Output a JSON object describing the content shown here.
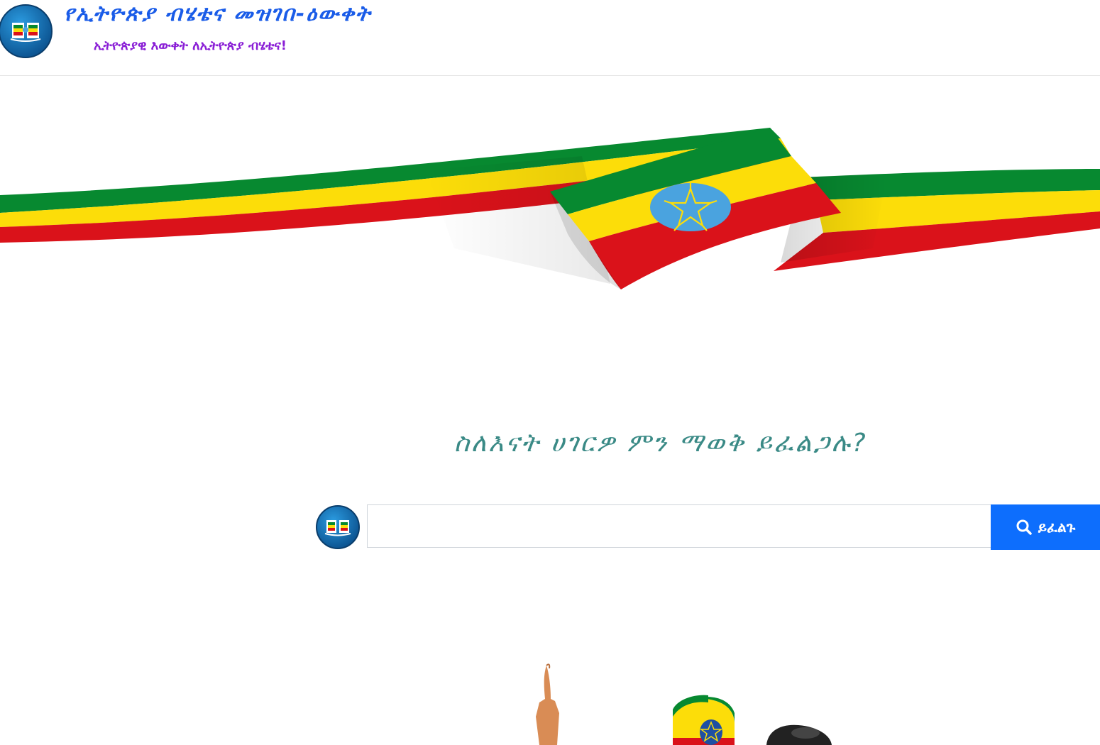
{
  "header": {
    "title": "የኢትዮጵያ ብሄቴና መዝገበ-ዕውቀት",
    "tagline": "ኢትዮጵያዊ እውቀት ለኢትዮጵያ ብሄቴና!"
  },
  "main": {
    "question": "ስለእናት ሀገርዎ ምን ማወቅ ይፈልጋሉ?",
    "search": {
      "value": "",
      "placeholder": "",
      "button_label": "ይፈልጉ"
    }
  },
  "colors": {
    "brand_blue": "#1a5ce8",
    "tagline_purple": "#8a1fd6",
    "question_teal": "#3a8a86",
    "button_blue": "#0d6efd",
    "flag_green": "#078930",
    "flag_yellow": "#fcdd09",
    "flag_red": "#da121a",
    "emblem_blue": "#4aa3df"
  },
  "icons": {
    "logo": "book-flag-logo-icon",
    "search": "search-icon"
  }
}
